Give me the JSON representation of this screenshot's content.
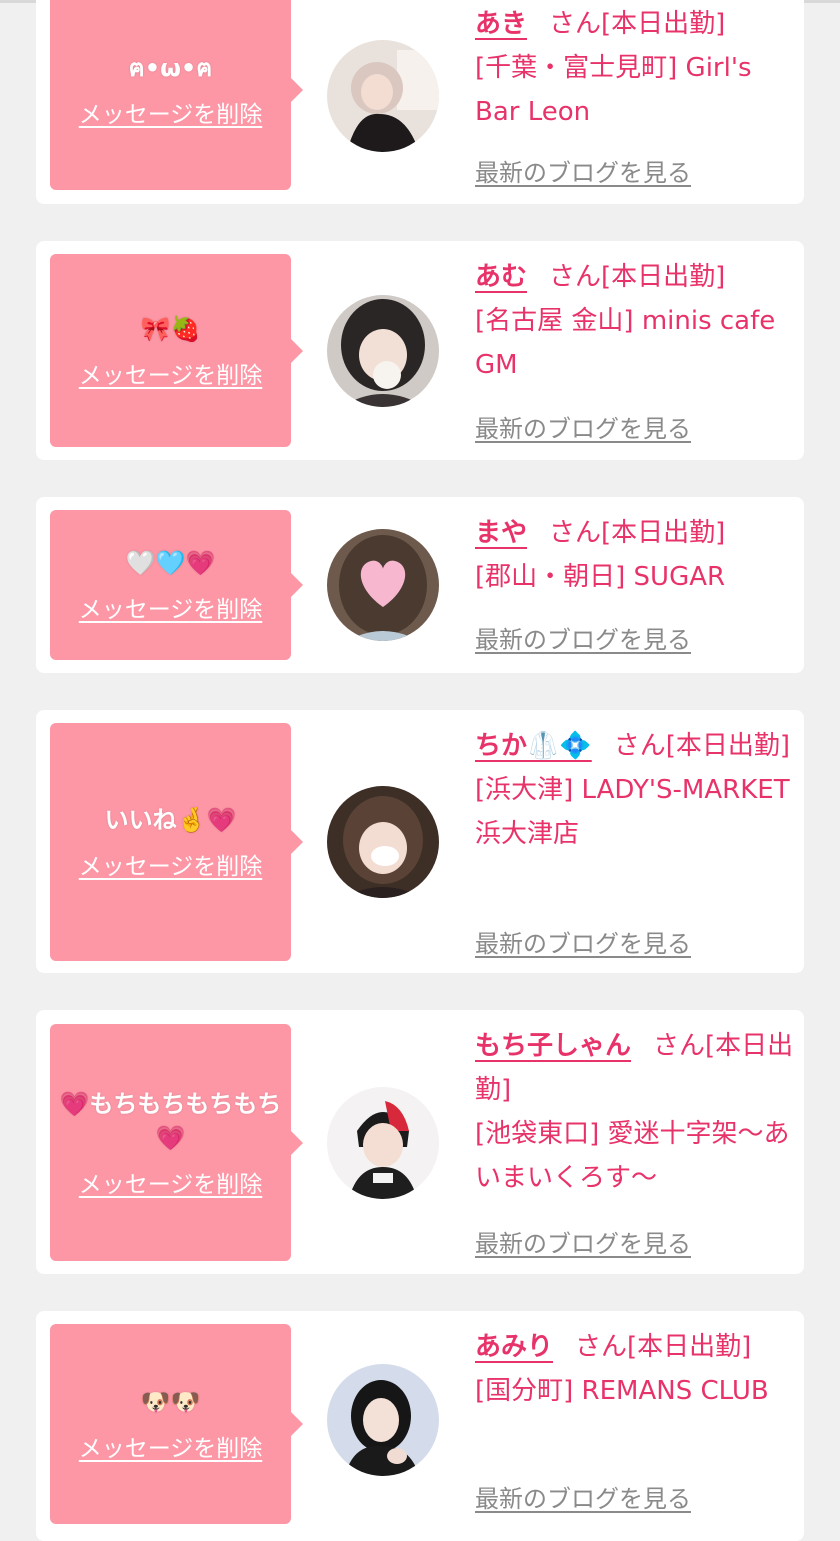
{
  "cards": [
    {
      "message": "ฅ•ω•ฅ",
      "delete_label": "メッセージを削除",
      "name": "あき",
      "suffix": "さん[本日出勤]",
      "shop": "[千葉・富士見町] Girl's Bar Leon",
      "blog_label": "最新のブログを見る"
    },
    {
      "message": "🎀🍓",
      "delete_label": "メッセージを削除",
      "name": "あむ",
      "suffix": "さん[本日出勤]",
      "shop": "[名古屋 金山] minis cafe GM",
      "blog_label": "最新のブログを見る"
    },
    {
      "message": "🤍🩵💗",
      "delete_label": "メッセージを削除",
      "name": "まや",
      "suffix": "さん[本日出勤]",
      "shop": "[郡山・朝日] SUGAR",
      "blog_label": "最新のブログを見る"
    },
    {
      "message": "いいね🤞💗",
      "delete_label": "メッセージを削除",
      "name": "ちか🥼💠",
      "suffix": "さん[本日出勤]",
      "shop": "[浜大津] LADY'S-MARKET 浜大津店",
      "blog_label": "最新のブログを見る"
    },
    {
      "message": "💗もちもちもちもち💗",
      "delete_label": "メッセージを削除",
      "name": "もち子しゃん",
      "suffix": "さん[本日出勤]",
      "shop": "[池袋東口] 愛迷十字架〜あいまいくろす〜",
      "blog_label": "最新のブログを見る"
    },
    {
      "message": "🐶🐶",
      "delete_label": "メッセージを削除",
      "name": "あみり",
      "suffix": "さん[本日出勤]",
      "shop": "[国分町] REMANS CLUB",
      "blog_label": "最新のブログを見る"
    }
  ],
  "colors": {
    "accent": "#e8336a",
    "bubble": "#fd97a6",
    "background": "#f0f0f0",
    "link_gray": "#8a8a8a"
  }
}
